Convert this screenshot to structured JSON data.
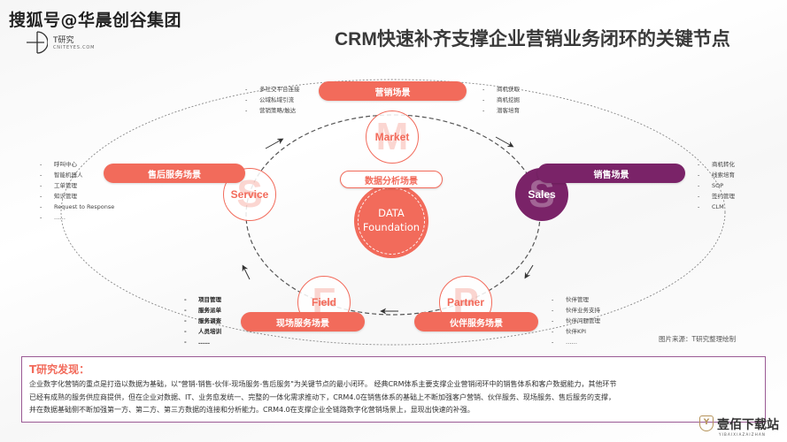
{
  "watermark": "搜狐号@华晨创谷集团",
  "logo": {
    "name": "T研究",
    "url": "CNITEYES.COM"
  },
  "title": "CRM快速补齐支撑企业营销业务闭环的关键节点",
  "colors": {
    "accent": "#f26b5b",
    "sales": "#7a2368",
    "border": "#9a5a94"
  },
  "center": {
    "pill": "数据分析场景",
    "line1": "DATA",
    "line2": "Foundation"
  },
  "nodes": {
    "market": {
      "letter": "M",
      "label": "Market",
      "scene": "营销场景",
      "left_items": [
        "多社交平台连接",
        "公域私域引流",
        "营销策略/触达"
      ],
      "right_items": [
        "商机获取",
        "商机挖掘",
        "潜客培育"
      ]
    },
    "sales": {
      "letter": "S",
      "label": "Sales",
      "scene": "销售场景",
      "items": [
        "商机转化",
        "线索培育",
        "SOP",
        "签约管理",
        "CLM"
      ]
    },
    "partner": {
      "letter": "P",
      "label": "Partner",
      "scene": "伙伴服务场景",
      "items": [
        "伙伴管理",
        "伙伴业务支持",
        "伙伴问题管理",
        "伙伴KPI",
        "……"
      ]
    },
    "field": {
      "letter": "F",
      "label": "Field",
      "scene": "现场服务场景",
      "items": [
        "项目管理",
        "服务派单",
        "服务调查",
        "人员培训",
        "……"
      ]
    },
    "service": {
      "letter": "S",
      "label": "Service",
      "scene": "售后服务场景",
      "items": [
        "呼叫中心",
        "智能机器人",
        "工单管理",
        "知识管理",
        "Request to Response",
        "……"
      ]
    }
  },
  "source_note": "图片来源：T研究整理绘制",
  "findings": {
    "title": "T研究发现：",
    "lines": [
      "企业数字化营销的重点是打造以数据为基础，以\"营销-销售-伙伴-现场服务-售后服务\"为关键节点的最小闭环。 经典CRM体系主要支撑企业营销闭环中的销售体系和客户数据能力，其他环节",
      "已经有成熟的服务供应商提供，但在企业对数据、IT、业务愈发统一、完整的一体化需求推动下，CRM4.0在销售体系的基础上不断加强客户营销、伙伴服务、现场服务、售后服务的支撑，",
      "并在数据基础侧不断加强第一方、第二方、第三方数据的连接和分析能力。CRM4.0在支撑企业全链路数字化营销场景上，显现出快速的补强。"
    ]
  },
  "footer_logo": {
    "mark": "Y",
    "name": "壹佰下载站",
    "sub": "YIBAIXIAZAIZHAN"
  }
}
